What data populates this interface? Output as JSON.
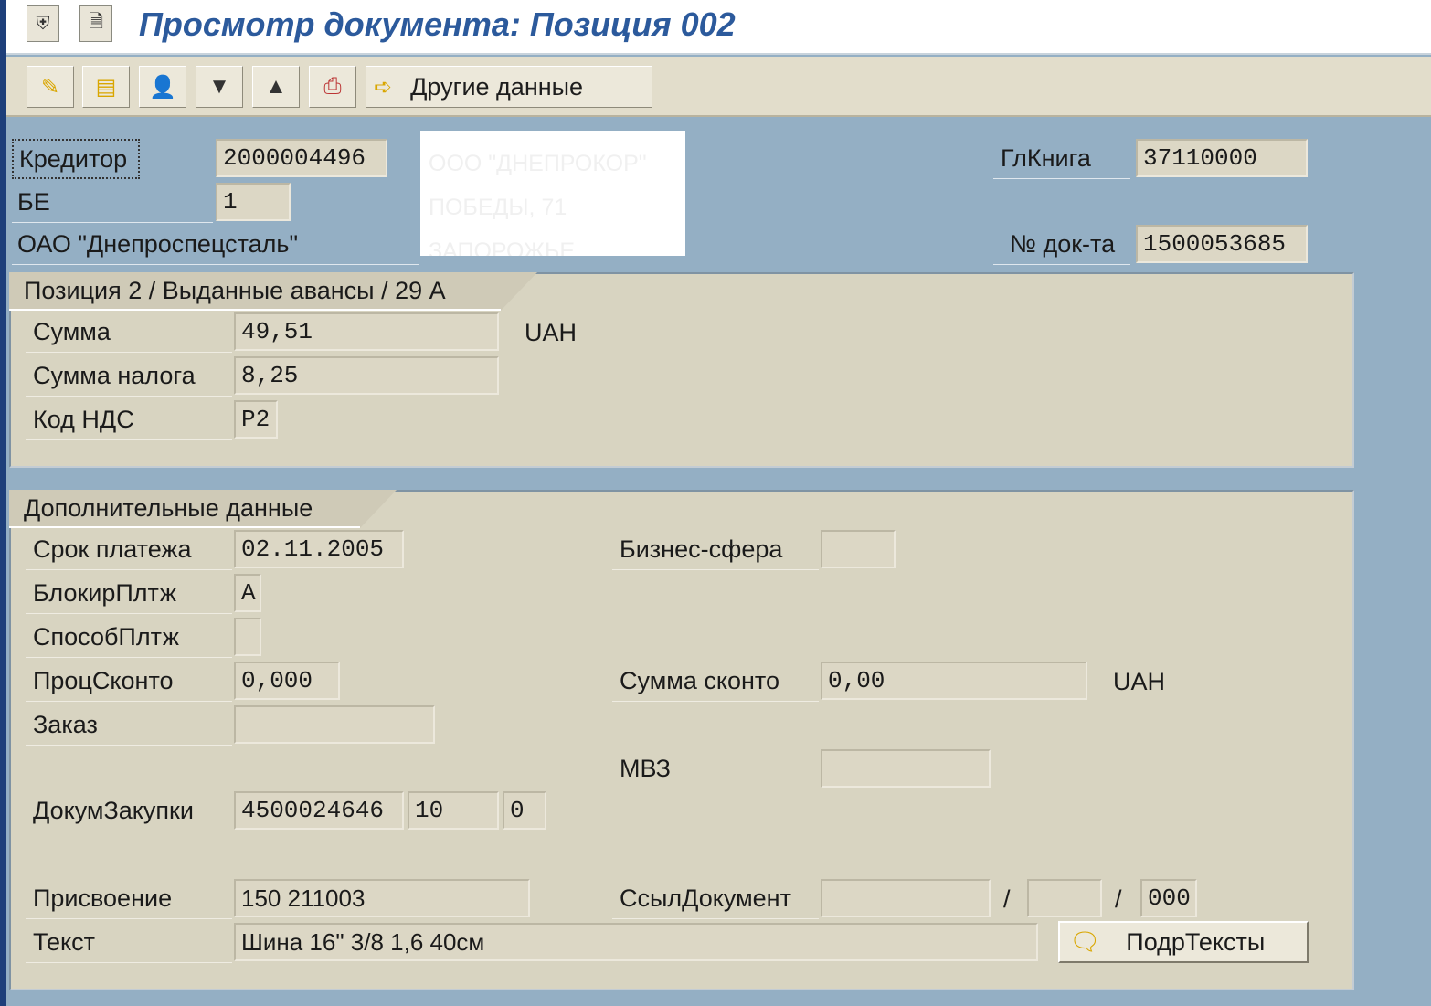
{
  "window": {
    "title": "Просмотр документа: Позиция 002"
  },
  "toolbar": {
    "other_data_label": "Другие данные"
  },
  "header": {
    "creditor_label": "Кредитор",
    "creditor_value": "2000004496",
    "be_label": "БЕ",
    "be_value": "1",
    "company_name": "ОАО \"Днепроспецсталь\"",
    "address_lines": [
      "ООО \"ДНЕПРОКОР\"",
      "ПОБЕДЫ, 71",
      "ЗАПОРОЖЬЕ"
    ],
    "gl_label": "ГлКнига",
    "gl_value": "37110000",
    "doc_no_label": "№ док-та",
    "doc_no_value": "1500053685"
  },
  "position_group": {
    "title": "Позиция 2 / Выданные авансы / 29 A",
    "amount_label": "Сумма",
    "amount_value": "49,51",
    "amount_currency": "UAH",
    "tax_label": "Сумма налога",
    "tax_value": "8,25",
    "vat_code_label": "Код НДС",
    "vat_code_value": "P2"
  },
  "additional_group": {
    "title": "Дополнительные данные",
    "due_date_label": "Срок платежа",
    "due_date_value": "02.11.2005",
    "business_area_label": "Бизнес-сфера",
    "business_area_value": "",
    "payment_block_label": "БлокирПлтж",
    "payment_block_value": "A",
    "payment_method_label": "СпособПлтж",
    "payment_method_value": "",
    "discount_pct_label": "ПроцСконто",
    "discount_pct_value": "0,000",
    "discount_amount_label": "Сумма сконто",
    "discount_amount_value": "0,00",
    "discount_currency": "UAH",
    "order_label": "Заказ",
    "order_value": "",
    "mvz_label": "МВЗ",
    "mvz_value": "",
    "purchase_doc_label": "ДокумЗакупки",
    "purchase_doc_value": "4500024646",
    "purchase_item_value": "10",
    "purchase_extra_value": "0",
    "assignment_label": "Присвоение",
    "assignment_value": "150 211003",
    "ref_doc_label": "СсылДокумент",
    "ref_doc_value": "",
    "ref_sep": "/",
    "ref_doc_part2": "",
    "ref_doc_part3": "000",
    "text_label": "Текст",
    "text_value": "Шина 16\" 3/8 1,6 40см",
    "subtexts_button": "ПодрТексты"
  }
}
